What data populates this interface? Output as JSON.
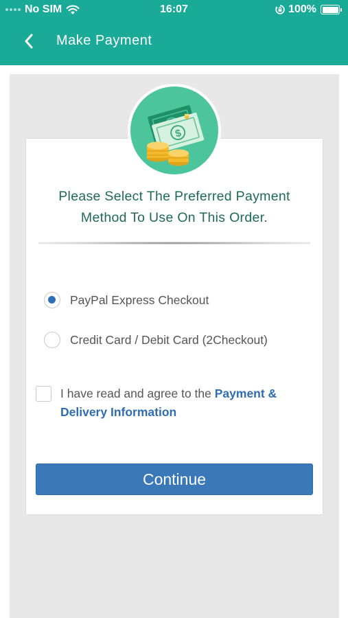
{
  "status_bar": {
    "carrier": "No SIM",
    "time": "16:07",
    "battery": "100%"
  },
  "nav": {
    "title": "Make Payment"
  },
  "card": {
    "heading_line1": "Please Select The Preferred Payment",
    "heading_line2": "Method To Use On This Order.",
    "payment_methods": [
      {
        "label": "PayPal Express Checkout",
        "selected": true
      },
      {
        "label": "Credit Card / Debit Card (2Checkout)",
        "selected": false
      }
    ],
    "agree": {
      "text": "I have read and agree to the ",
      "link_line1": "Payment &",
      "link_line2": "Delivery Information",
      "checked": false
    },
    "continue_label": "Continue"
  },
  "colors": {
    "header": "#1aaa98",
    "heading_text": "#1e6b55",
    "accent_blue": "#3a78b8",
    "icon_bg": "#4cc59d"
  },
  "icons": [
    "wifi-icon",
    "orientation-lock-icon",
    "battery-icon",
    "back-arrow-icon",
    "money-coins-icon"
  ]
}
